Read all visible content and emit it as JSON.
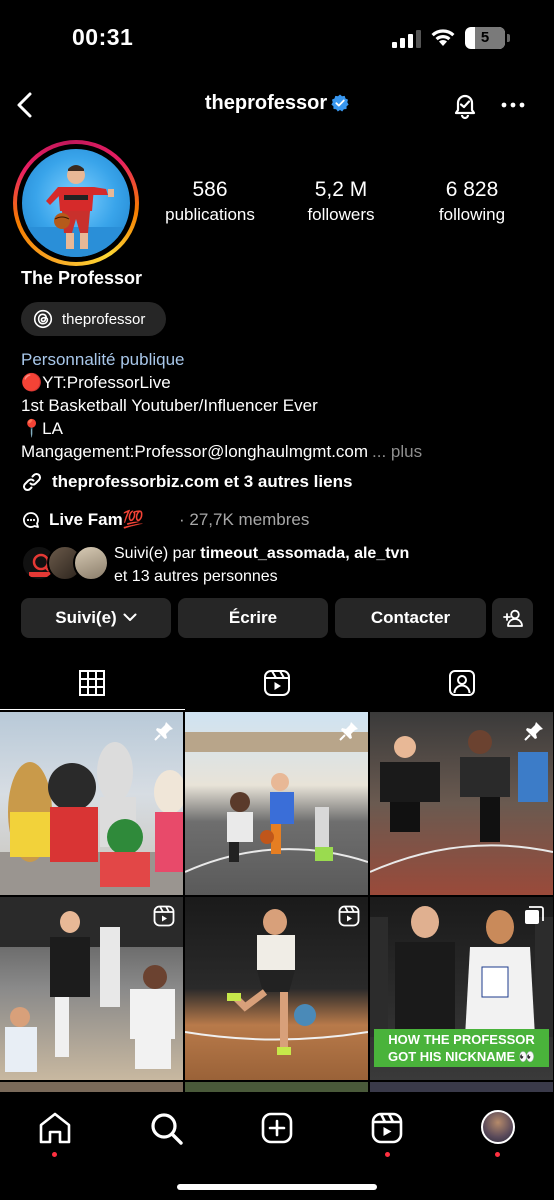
{
  "status_bar": {
    "time": "00:31",
    "battery": "5"
  },
  "header": {
    "username": "theprofessor"
  },
  "profile": {
    "display_name": "The Professor",
    "threads_handle": "theprofessor",
    "stats": [
      {
        "value": "586",
        "label": "publications"
      },
      {
        "value": "5,2 M",
        "label": "followers"
      },
      {
        "value": "6 828",
        "label": "following"
      }
    ],
    "bio": {
      "category": "Personnalité publique",
      "lines": [
        "🔴YT:ProfessorLive",
        "1st Basketball Youtuber/Influencer Ever",
        "📍LA",
        "Mangagement:Professor@longhaulmgmt.com"
      ],
      "more": "... plus"
    },
    "links": "theprofessorbiz.com et 3 autres liens",
    "community": {
      "name": "Live Fam💯",
      "meta": "· 27,7K membres"
    },
    "followed_by": {
      "prefix": "Suivi(e) par ",
      "names": "timeout_assomada, ale_tvn",
      "line2": "et 13 autres personnes"
    }
  },
  "actions": {
    "following": "Suivi(e)",
    "message": "Écrire",
    "contact": "Contacter"
  },
  "grid_overlay_caption": "HOW THE PROFESSOR GOT HIS NICKNAME 👀",
  "colors": {
    "accent_link": "#a8c7ea",
    "button_bg": "#262626",
    "notification_dot": "#ff3040",
    "caption_green": "#4ab33b"
  }
}
